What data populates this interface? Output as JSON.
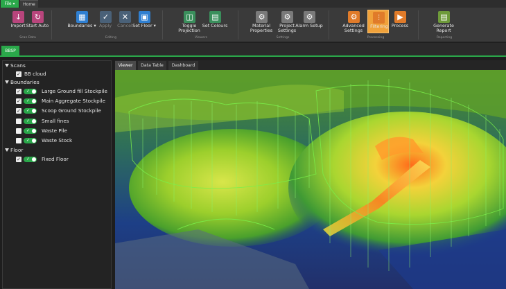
{
  "menubar": {
    "file_label": "File ▾",
    "home_tab": "Home"
  },
  "ribbon": {
    "buttons": [
      {
        "id": "import",
        "label": "Import"
      },
      {
        "id": "start_auto",
        "label": "Start Auto"
      },
      {
        "id": "boundaries",
        "label": "Boundaries ▾"
      },
      {
        "id": "apply",
        "label": "Apply"
      },
      {
        "id": "cancel",
        "label": "Cancel"
      },
      {
        "id": "set_floor",
        "label": "Set Floor ▾"
      },
      {
        "id": "toggle_projection",
        "label": "Toggle Projection"
      },
      {
        "id": "set_colours",
        "label": "Set Colours"
      },
      {
        "id": "material_properties",
        "label": "Material Properties"
      },
      {
        "id": "project_settings",
        "label": "Project Settings"
      },
      {
        "id": "alarm_setup",
        "label": "Alarm Setup"
      },
      {
        "id": "advanced_settings",
        "label": "Advanced Settings"
      },
      {
        "id": "filtering",
        "label": "Filtering"
      },
      {
        "id": "process",
        "label": "Process"
      },
      {
        "id": "generate_report",
        "label": "Generate Report"
      }
    ],
    "groups": {
      "scan_data": "Scan Data",
      "editing": "Editing",
      "viewers": "Viewers",
      "settings": "Settings",
      "processing": "Processing",
      "reporting": "Reporting"
    }
  },
  "project_tab": "BBSP",
  "tree": {
    "scans_header": "Scans",
    "scans": [
      {
        "label": "BB cloud"
      }
    ],
    "boundaries_header": "Boundaries",
    "boundaries": [
      {
        "label": "Large Ground fill Stockpile",
        "checked": true
      },
      {
        "label": "Main Aggregate Stockpile",
        "checked": true
      },
      {
        "label": "Scoop Ground Stockpile",
        "checked": true
      },
      {
        "label": "Small fines",
        "checked": false
      },
      {
        "label": "Waste Pile",
        "checked": false
      },
      {
        "label": "Waste Stock",
        "checked": false
      }
    ],
    "floor_header": "Floor",
    "floor": [
      {
        "label": "Fixed Floor",
        "checked": true
      }
    ],
    "toggle_mark": "✓"
  },
  "viewer_tabs": {
    "viewer": "Viewer",
    "data_table": "Data Table",
    "dashboard": "Dashboard"
  },
  "colors": {
    "accent_green": "#2aa84a",
    "active_orange": "#f0a23b"
  }
}
